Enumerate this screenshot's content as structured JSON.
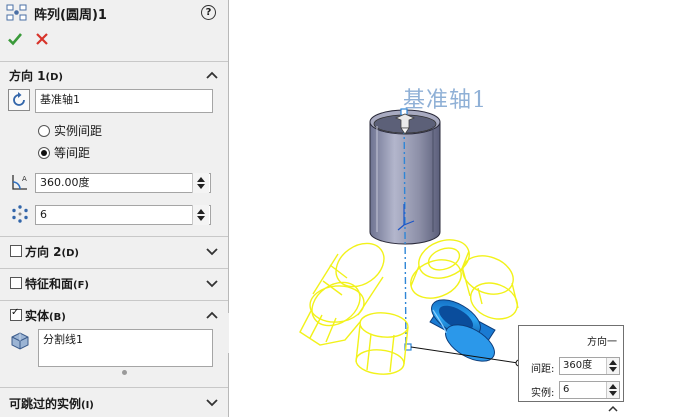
{
  "panel": {
    "title": "阵列(圆周)1",
    "help_icon": "?",
    "ok_icon": "checkmark-icon",
    "cancel_icon": "close-icon",
    "direction1": {
      "title": "方向 1",
      "shortcut": "(D)",
      "axis_value": "基准轴1",
      "option_instance_spacing": "实例间距",
      "option_equal_spacing": "等间距",
      "selected_option": "等间距",
      "angle_value": "360.00度",
      "count_value": "6"
    },
    "direction2": {
      "title": "方向 2",
      "shortcut": "(D)",
      "checked": false
    },
    "features_faces": {
      "title": "特征和面",
      "shortcut": "(F)",
      "checked": false
    },
    "bodies": {
      "title": "实体",
      "shortcut": "(B)",
      "checked": true,
      "selected_body": "分割线1"
    },
    "skip_instances": {
      "title": "可跳过的实例",
      "shortcut": "(I)"
    }
  },
  "viewport": {
    "axis_label": "基准轴1",
    "callout": {
      "title": "方向一",
      "spacing_label": "间距:",
      "spacing_value": "360度",
      "instances_label": "实例:",
      "instances_value": "6"
    }
  },
  "colors": {
    "panel_bg": "#f0f0f0",
    "ok_green": "#3a9a3a",
    "cancel_red": "#d8332a",
    "preview_yellow": "#f2f21a",
    "selected_blue": "#1f8fe0",
    "axis_blue": "#2f86d6",
    "axis_label": "#8fb0d6"
  }
}
